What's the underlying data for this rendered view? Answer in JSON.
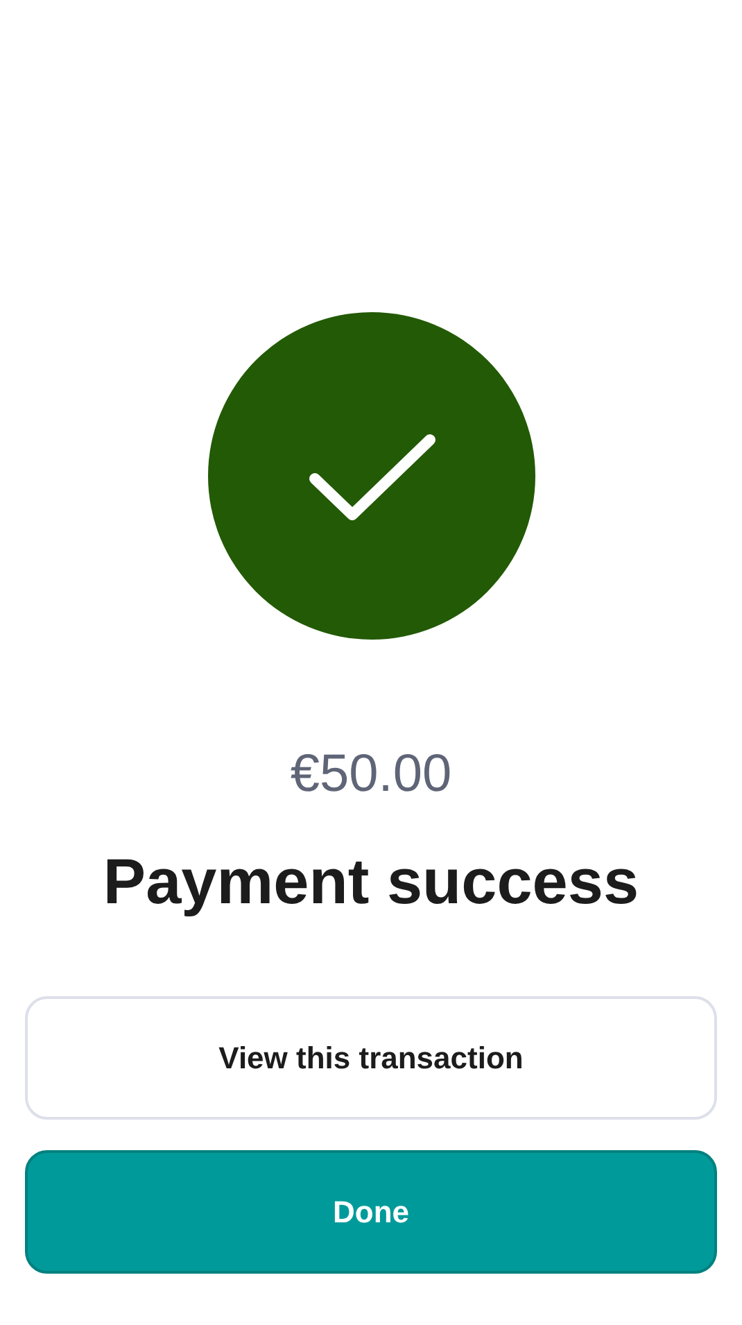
{
  "status": {
    "kind": "success"
  },
  "amount": "€50.00",
  "title": "Payment success",
  "buttons": [
    {
      "label": "View this transaction",
      "kind": "secondary"
    },
    {
      "label": "Done",
      "kind": "primary"
    }
  ]
}
